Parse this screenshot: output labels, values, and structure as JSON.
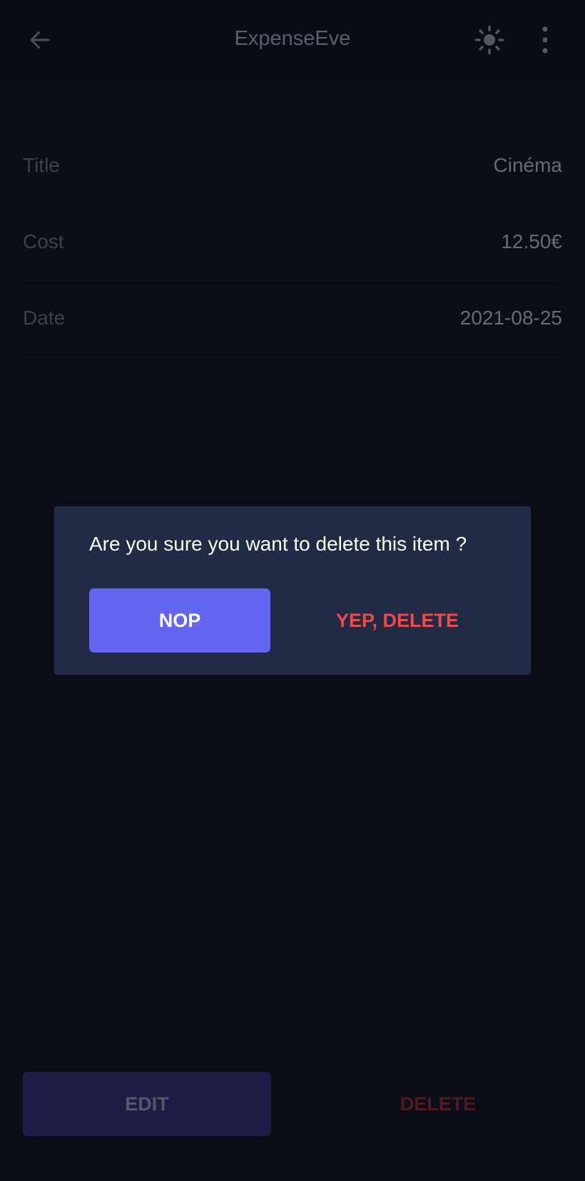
{
  "app_bar": {
    "title": "ExpenseEve",
    "back_icon": "arrow-left-icon",
    "theme_icon": "sun-icon",
    "menu_icon": "more-vertical-icon"
  },
  "details": [
    {
      "label": "Title",
      "value": "Cinéma"
    },
    {
      "label": "Cost",
      "value": "12.50€"
    },
    {
      "label": "Date",
      "value": "2021-08-25"
    }
  ],
  "dialog": {
    "message": "Are you sure you want to delete this item ?",
    "cancel_label": "NOP",
    "confirm_label": "YEP, DELETE"
  },
  "actions": {
    "edit_label": "EDIT",
    "delete_label": "DELETE"
  },
  "colors": {
    "background": "#0b0e19",
    "dialog_bg": "#222b45",
    "primary": "#6366f0",
    "danger": "#ef4a4a"
  }
}
